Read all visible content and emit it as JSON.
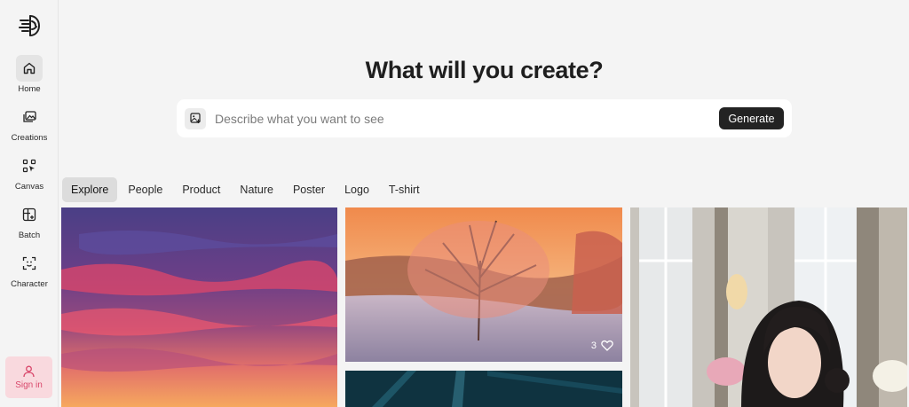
{
  "sidebar": {
    "items": [
      {
        "label": "Home",
        "icon": "home-icon"
      },
      {
        "label": "Creations",
        "icon": "images-icon"
      },
      {
        "label": "Canvas",
        "icon": "canvas-icon"
      },
      {
        "label": "Batch",
        "icon": "batch-icon"
      },
      {
        "label": "Character",
        "icon": "character-icon"
      }
    ],
    "signin_label": "Sign in"
  },
  "hero": {
    "title": "What will you create?",
    "placeholder": "Describe what you want to see",
    "generate_label": "Generate"
  },
  "tabs": [
    "Explore",
    "People",
    "Product",
    "Nature",
    "Poster",
    "Logo",
    "T-shirt"
  ],
  "gallery": {
    "cards": [
      {
        "subject": "purple sunset sky"
      },
      {
        "subject": "frosted tree at sunrise",
        "likes": "3"
      },
      {
        "subject": "dark teal interior"
      },
      {
        "subject": "woman by window with flowers"
      }
    ]
  },
  "colors": {
    "accent": "#232323",
    "signin_bg": "#f9d9de",
    "signin_text": "#d9486b"
  }
}
